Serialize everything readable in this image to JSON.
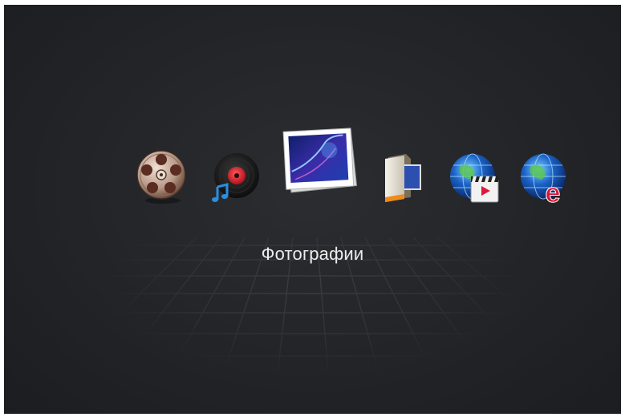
{
  "menu": {
    "selected_label": "Фотографии",
    "items": [
      {
        "id": "video",
        "icon": "film-reel-icon"
      },
      {
        "id": "music",
        "icon": "music-record-icon"
      },
      {
        "id": "photos",
        "icon": "photo-frame-icon",
        "selected": true
      },
      {
        "id": "files",
        "icon": "file-folder-icon"
      },
      {
        "id": "online-video",
        "icon": "globe-video-icon"
      },
      {
        "id": "browser",
        "icon": "globe-browser-icon"
      }
    ]
  },
  "colors": {
    "background": "#23252a",
    "label_text": "#ececec",
    "accent_red": "#d8173a",
    "globe_blue": "#1b63c8"
  }
}
